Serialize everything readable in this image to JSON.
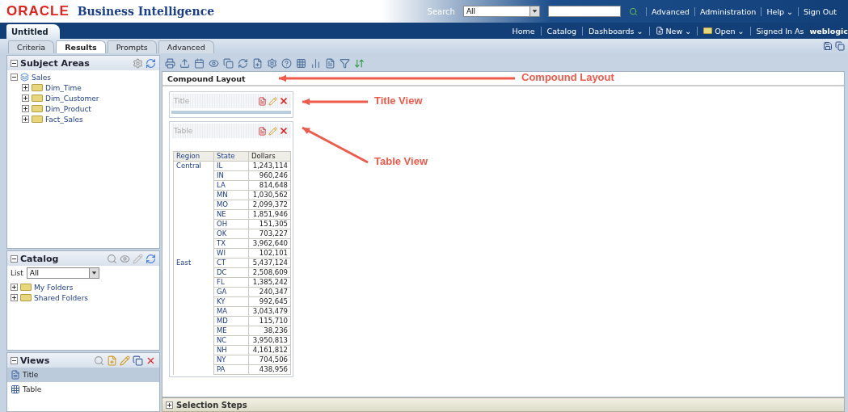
{
  "header": {
    "logo": "ORACLE",
    "product": "Business Intelligence",
    "search_label": "Search",
    "search_scope": "All",
    "links": [
      "Advanced",
      "Administration",
      "Help ⌄",
      "Sign Out"
    ]
  },
  "navbar": {
    "document_tab": "Untitled",
    "links": [
      {
        "label": "Home",
        "kind": "plain"
      },
      {
        "label": "Catalog",
        "kind": "plain"
      },
      {
        "label": "Dashboards ⌄",
        "kind": "plain"
      },
      {
        "label": "New ⌄",
        "kind": "new"
      },
      {
        "label": "Open ⌄",
        "kind": "open"
      },
      {
        "label": "Signed In As",
        "kind": "plain"
      }
    ],
    "user": "weblogic"
  },
  "editor_tabs": [
    {
      "label": "Criteria",
      "selected": false
    },
    {
      "label": "Results",
      "selected": true
    },
    {
      "label": "Prompts",
      "selected": false
    },
    {
      "label": "Advanced",
      "selected": false
    }
  ],
  "subject_areas": {
    "title": "Subject Areas",
    "tree": [
      {
        "label": "Sales",
        "expanded": true,
        "children": [
          {
            "label": "Dim_Time",
            "expanded": false
          },
          {
            "label": "Dim_Customer",
            "expanded": false
          },
          {
            "label": "Dim_Product",
            "expanded": false
          },
          {
            "label": "Fact_Sales",
            "expanded": false
          }
        ]
      }
    ]
  },
  "catalog": {
    "title": "Catalog",
    "list_label": "List",
    "list_value": "All",
    "items": [
      {
        "label": "My Folders",
        "expanded": false
      },
      {
        "label": "Shared Folders",
        "expanded": false
      }
    ]
  },
  "views": {
    "title": "Views",
    "items": [
      {
        "label": "Title",
        "kind": "title",
        "selected": true
      },
      {
        "label": "Table",
        "kind": "table",
        "selected": false
      }
    ]
  },
  "layout": {
    "title": "Compound Layout",
    "view_boxes": [
      {
        "label": "Title",
        "kind": "title"
      },
      {
        "label": "Table",
        "kind": "table"
      }
    ]
  },
  "table": {
    "columns": [
      "Region",
      "State",
      "Dollars"
    ],
    "groups": [
      {
        "region": "Central",
        "rows": [
          [
            "IL",
            "1,243,114"
          ],
          [
            "IN",
            "960,246"
          ],
          [
            "LA",
            "814,648"
          ],
          [
            "MN",
            "1,030,562"
          ],
          [
            "MO",
            "2,099,372"
          ],
          [
            "NE",
            "1,851,946"
          ],
          [
            "OH",
            "151,305"
          ],
          [
            "OK",
            "703,227"
          ],
          [
            "TX",
            "3,962,640"
          ],
          [
            "WI",
            "102,101"
          ]
        ]
      },
      {
        "region": "East",
        "rows": [
          [
            "CT",
            "5,437,124"
          ],
          [
            "DC",
            "2,508,609"
          ],
          [
            "FL",
            "1,385,242"
          ],
          [
            "GA",
            "240,347"
          ],
          [
            "KY",
            "992,645"
          ],
          [
            "MA",
            "3,043,479"
          ],
          [
            "MD",
            "115,710"
          ],
          [
            "ME",
            "38,236"
          ],
          [
            "NC",
            "3,950,813"
          ],
          [
            "NH",
            "4,161,812"
          ],
          [
            "NY",
            "704,506"
          ],
          [
            "PA",
            "438,956"
          ]
        ]
      }
    ]
  },
  "selection_steps": {
    "label": "Selection Steps",
    "expanded": false
  },
  "annotations": [
    {
      "label": "Compound Layout"
    },
    {
      "label": "Title View"
    },
    {
      "label": "Table View"
    }
  ]
}
